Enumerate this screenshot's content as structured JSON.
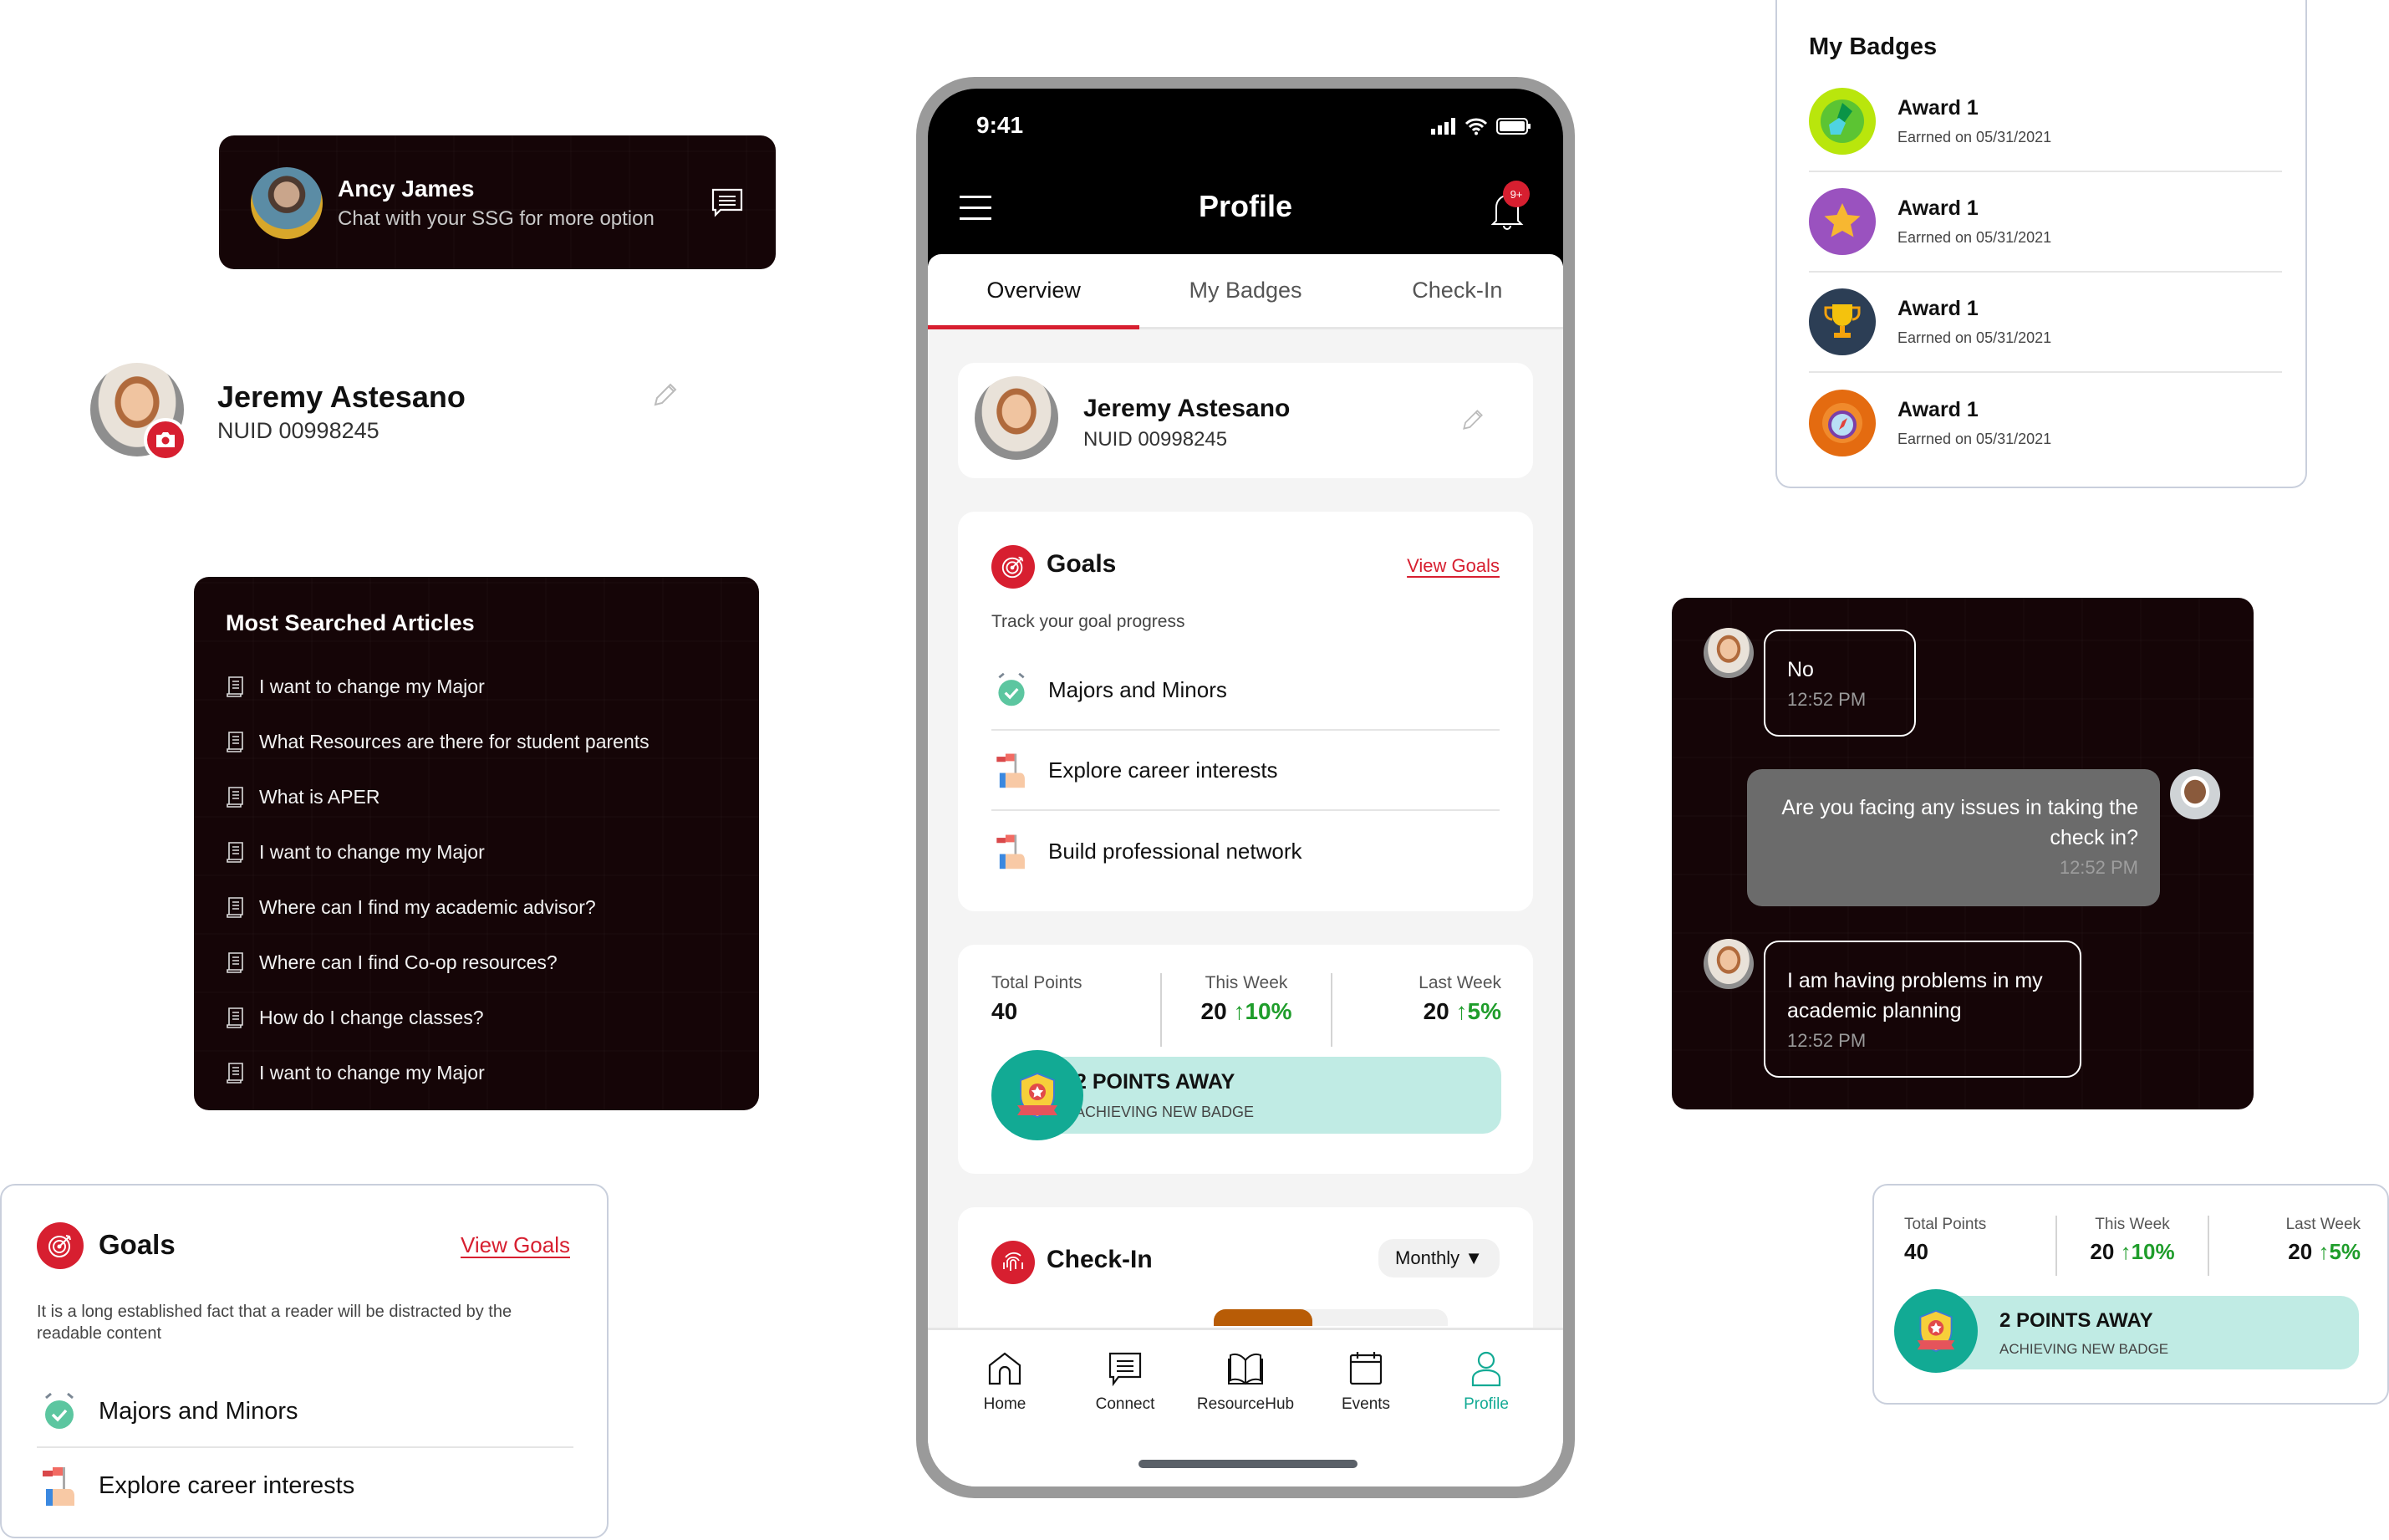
{
  "ssg_card": {
    "name": "Ancy James",
    "subtitle": "Chat with your SSG for more option",
    "icon": "chat-icon"
  },
  "profile_header": {
    "name": "Jeremy Astesano",
    "nuid": "NUID 00998245",
    "icons": [
      "camera-icon",
      "edit-pencil-icon"
    ]
  },
  "articles": {
    "title": "Most Searched Articles",
    "items": [
      "I want to change my Major",
      "What Resources are there for student parents",
      "What is APER",
      "I want to change my Major",
      "Where can I find my academic advisor?",
      "Where can I find Co-op resources?",
      "How do I change classes?",
      "I want to change my Major"
    ]
  },
  "goals_small": {
    "title": "Goals",
    "link": "View Goals",
    "description": "It is a long established fact that a reader will be distracted by the readable content",
    "items": [
      "Majors and Minors",
      "Explore career interests"
    ]
  },
  "phone": {
    "status_time": "9:41",
    "title": "Profile",
    "notification_badge": "9+",
    "tabs": [
      {
        "label": "Overview",
        "active": true
      },
      {
        "label": "My Badges",
        "active": false
      },
      {
        "label": "Check-In",
        "active": false
      }
    ],
    "profile": {
      "name": "Jeremy Astesano",
      "nuid": "NUID 00998245"
    },
    "goals": {
      "title": "Goals",
      "link": "View Goals",
      "description": "Track your goal progress",
      "items": [
        "Majors and Minors",
        "Explore career interests",
        "Build professional network"
      ]
    },
    "points": {
      "total_label": "Total Points",
      "total_value": "40",
      "this_week_label": "This Week",
      "this_week_value": "20",
      "this_week_change": "10%",
      "last_week_label": "Last Week",
      "last_week_value": "20",
      "last_week_change": "5%",
      "banner_title": "2  POINTS AWAY",
      "banner_subtitle": "ACHIEVING NEW BADGE"
    },
    "checkin": {
      "title": "Check-In",
      "period": "Monthly"
    },
    "nav": [
      {
        "label": "Home",
        "active": false
      },
      {
        "label": "Connect",
        "active": false
      },
      {
        "label": "ResourceHub",
        "active": false
      },
      {
        "label": "Events",
        "active": false
      },
      {
        "label": "Profile",
        "active": true
      }
    ]
  },
  "badges": {
    "title": "My Badges",
    "items": [
      {
        "name": "Award 1",
        "date": "Earrned on 05/31/2021",
        "icon": "running-shoe-badge-icon"
      },
      {
        "name": "Award 1",
        "date": "Earrned on 05/31/2021",
        "icon": "star-badge-icon"
      },
      {
        "name": "Award 1",
        "date": "Earrned on 05/31/2021",
        "icon": "trophy-badge-icon"
      },
      {
        "name": "Award 1",
        "date": "Earrned on 05/31/2021",
        "icon": "compass-badge-icon"
      }
    ]
  },
  "chat": {
    "messages": [
      {
        "text": "No",
        "time": "12:52 PM",
        "direction": "incoming"
      },
      {
        "text": "Are you facing any issues in taking the check in?",
        "time": "12:52 PM",
        "direction": "outgoing"
      },
      {
        "text": "I am having problems in my academic planning",
        "time": "12:52 PM",
        "direction": "incoming"
      }
    ]
  },
  "points_small": {
    "total_label": "Total Points",
    "total_value": "40",
    "this_week_label": "This Week",
    "this_week_value": "20",
    "this_week_change": "10%",
    "last_week_label": "Last Week",
    "last_week_value": "20",
    "last_week_change": "5%",
    "banner_title": "2  POINTS AWAY",
    "banner_subtitle": "ACHIEVING NEW BADGE"
  },
  "colors": {
    "brand_red": "#d71f30",
    "teal": "#12aa94",
    "teal_light": "#c0ebe4",
    "positive_green": "#1f9d2b",
    "dark_card": "#150507"
  }
}
